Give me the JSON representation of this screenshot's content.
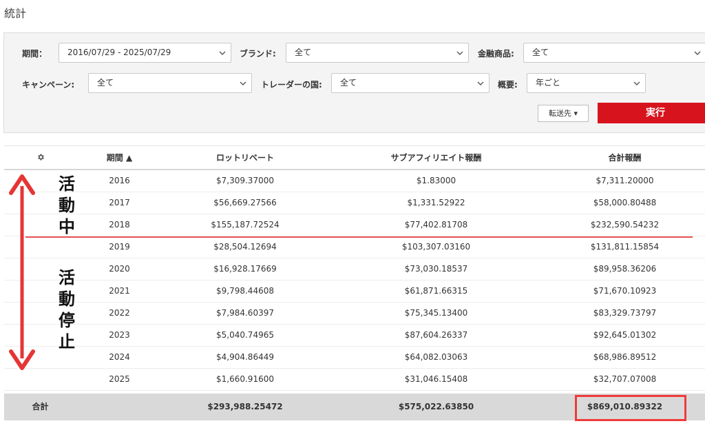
{
  "page": {
    "title": "統計"
  },
  "filters": {
    "period_label": "期間：",
    "period_value": "2016/07/29 - 2025/07/29",
    "brand_label": "ブランド:",
    "brand_value": "全て",
    "product_label": "金融商品:",
    "product_value": "全て",
    "campaign_label": "キャンペーン:",
    "campaign_value": "全て",
    "country_label": "トレーダーの国:",
    "country_value": "全て",
    "summary_label": "概要:",
    "summary_value": "年ごと",
    "forward_label": "転送先 ▾",
    "run_label": "実行"
  },
  "table": {
    "headers": {
      "settings_icon": "gear-icon",
      "period": "期間 ▲",
      "lot_rebate": "ロットリベート",
      "sub_affiliate": "サブアフィリエイト報酬",
      "total": "合計報酬"
    },
    "rows": [
      {
        "year": "2016",
        "lot_rebate": "$7,309.37000",
        "sub_affiliate": "$1.83000",
        "total": "$7,311.20000"
      },
      {
        "year": "2017",
        "lot_rebate": "$56,669.27566",
        "sub_affiliate": "$1,331.52922",
        "total": "$58,000.80488"
      },
      {
        "year": "2018",
        "lot_rebate": "$155,187.72524",
        "sub_affiliate": "$77,402.81708",
        "total": "$232,590.54232"
      },
      {
        "year": "2019",
        "lot_rebate": "$28,504.12694",
        "sub_affiliate": "$103,307.03160",
        "total": "$131,811.15854"
      },
      {
        "year": "2020",
        "lot_rebate": "$16,928.17669",
        "sub_affiliate": "$73,030.18537",
        "total": "$89,958.36206"
      },
      {
        "year": "2021",
        "lot_rebate": "$9,798.44608",
        "sub_affiliate": "$61,871.66315",
        "total": "$71,670.10923"
      },
      {
        "year": "2022",
        "lot_rebate": "$7,984.60397",
        "sub_affiliate": "$75,345.13400",
        "total": "$83,329.73797"
      },
      {
        "year": "2023",
        "lot_rebate": "$5,040.74965",
        "sub_affiliate": "$87,604.26337",
        "total": "$92,645.01302"
      },
      {
        "year": "2024",
        "lot_rebate": "$4,904.86449",
        "sub_affiliate": "$64,082.03063",
        "total": "$68,986.89512"
      },
      {
        "year": "2025",
        "lot_rebate": "$1,660.91600",
        "sub_affiliate": "$31,046.15408",
        "total": "$32,707.07008"
      }
    ],
    "totals": {
      "label": "合計",
      "lot_rebate": "$293,988.25472",
      "sub_affiliate": "$575,022.63850",
      "total": "$869,010.89322"
    }
  },
  "annotations": {
    "active_chars": [
      "活",
      "動",
      "中"
    ],
    "inactive_chars": [
      "活",
      "動",
      "停",
      "止"
    ],
    "accent_color": "#e53535"
  },
  "colors": {
    "run_button": "#d7141d",
    "total_row": "#d9d9d9",
    "panel": "#f4f4f4"
  }
}
